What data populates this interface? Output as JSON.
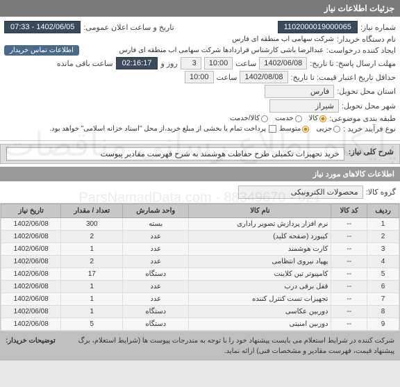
{
  "header": "جزئیات اطلاعات نیاز",
  "fields": {
    "need_no_label": "شماره نیاز:",
    "need_no": "1102000019000065",
    "pub_datetime_label": "تاریخ و ساعت اعلان عمومی:",
    "pub_datetime": "1402/06/05 - 07:33",
    "buyer_label": "نام دستگاه خریدار:",
    "buyer": "شرکت سهامی اب منطقه ای فارس",
    "creator_label": "ایجاد کننده درخواست:",
    "creator": "عبدالرضا باشی کارشناس قراردادها شرکت سهامی اب منطقه ای فارس",
    "contact_badge": "اطلاعات تماس خریدار",
    "deadline_label": "مهلت ارسال پاسخ: تا تاریخ:",
    "deadline_date": "1402/06/08",
    "deadline_time_label": "ساعت",
    "deadline_time": "10:00",
    "days_left_mid": "روز و",
    "days_left": "3",
    "time_left": "02:16:17",
    "time_left_suffix": "ساعت باقی مانده",
    "valid_label": "حداقل تاریخ اعتبار قیمت: تا تاریخ:",
    "valid_date": "1402/08/08",
    "valid_time": "10:00",
    "province_label": "استان محل تحویل:",
    "province": "فارس",
    "city_label": "شهر محل تحویل:",
    "city": "شیراز"
  },
  "category": {
    "label": "طبقه بندی موضوعی:",
    "options": [
      "کالا",
      "خدمت",
      "کالا/خدمت"
    ],
    "selected": 0
  },
  "buy_process": {
    "label": "نوع فرآیند خرید :",
    "options": [
      "جزیی",
      "متوسط"
    ],
    "selected": 1,
    "checkbox_text": "پرداخت تمام یا بخشی از مبلغ خرید،از محل \"اسناد خزانه اسلامی\" خواهد بود."
  },
  "desc": {
    "label": "شرح کلی نیاز:",
    "value": "خرید تجهیزات تکمیلی طرح حفاظت هوشمند به شرح فهرست مقادیر پیوست"
  },
  "items_header": "اطلاعات کالاهای مورد نیاز",
  "group": {
    "label": "گروه کالا:",
    "value": "محصولات الکترونیکی"
  },
  "columns": [
    "ردیف",
    "کد کالا",
    "نام کالا",
    "واحد شمارش",
    "تعداد / مقدار",
    "تاریخ نیاز"
  ],
  "rows": [
    {
      "n": "1",
      "code": "--",
      "name": "نرم افزار پردازش تصویر راداری",
      "unit": "بسته",
      "qty": "300",
      "date": "1402/06/08"
    },
    {
      "n": "2",
      "code": "--",
      "name": "کیبورد (صفحه کلید)",
      "unit": "عدد",
      "qty": "2",
      "date": "1402/06/08"
    },
    {
      "n": "3",
      "code": "--",
      "name": "کارت هوشمند",
      "unit": "عدد",
      "qty": "1",
      "date": "1402/06/08"
    },
    {
      "n": "4",
      "code": "--",
      "name": "پهپاد نیروی انتظامی",
      "unit": "عدد",
      "qty": "2",
      "date": "1402/06/08"
    },
    {
      "n": "5",
      "code": "--",
      "name": "کامپیوتر تین کلاینت",
      "unit": "دستگاه",
      "qty": "17",
      "date": "1402/06/08"
    },
    {
      "n": "6",
      "code": "--",
      "name": "قفل برقی درب",
      "unit": "عدد",
      "qty": "1",
      "date": "1402/06/08"
    },
    {
      "n": "7",
      "code": "--",
      "name": "تجهیزات تست کنترل کننده",
      "unit": "عدد",
      "qty": "1",
      "date": "1402/06/08"
    },
    {
      "n": "8",
      "code": "--",
      "name": "دوربین عکاسی",
      "unit": "دستگاه",
      "qty": "1",
      "date": "1402/06/08"
    },
    {
      "n": "9",
      "code": "--",
      "name": "دوربین امنیتی",
      "unit": "دستگاه",
      "qty": "5",
      "date": "1402/06/08"
    }
  ],
  "note": {
    "label": "توضیحات خریدار:",
    "text": "شرکت کننده در شرایط استعلام می بایست پیشنهاد خود را با توجه به مندرجات پیوست ها (شرایط استعلام، برگ پیشنهاد قیمت، فهرست مقادیر و مشخصات فنی) ارائه نماید."
  },
  "watermark1": "پایگاه اطلاع رسانی مناقصات",
  "watermark2": "ParsNamadData.com - 88349670 - 021"
}
